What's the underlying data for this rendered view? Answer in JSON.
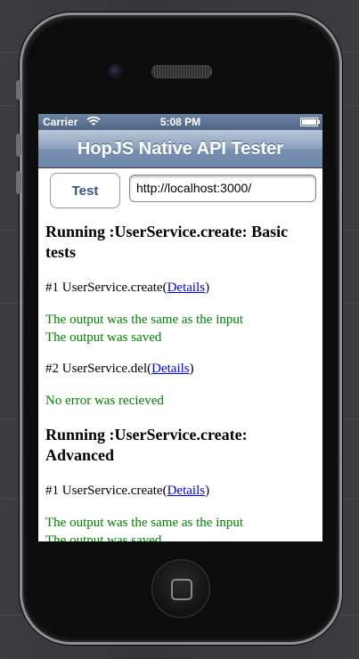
{
  "status_bar": {
    "carrier": "Carrier",
    "time": "5:08 PM"
  },
  "nav": {
    "title": "HopJS Native API Tester"
  },
  "toolbar": {
    "test_label": "Test",
    "url_value": "http://localhost:3000/"
  },
  "results": {
    "basic": {
      "heading": "Running :UserService.create: Basic tests",
      "t1": {
        "prefix": "#1 UserService.create(",
        "link": "Details",
        "suffix": ")"
      },
      "t1_out1": "The output was the same as the input",
      "t1_out2": "The output was saved",
      "t2": {
        "prefix": "#2 UserService.del(",
        "link": "Details",
        "suffix": ")"
      },
      "t2_out1": "No error was recieved"
    },
    "advanced": {
      "heading": "Running :UserService.create: Advanced",
      "t1": {
        "prefix": "#1 UserService.create(",
        "link": "Details",
        "suffix": ")"
      },
      "t1_out1": "The output was the same as the input",
      "t1_out2": "The output was saved"
    }
  },
  "colors": {
    "nav_blue": "#7890b1",
    "button_text": "#385487",
    "success": "#008000",
    "link": "#0000ee"
  },
  "icons": {
    "wifi": "wifi-icon",
    "battery": "battery-icon",
    "home": "home-button-icon"
  }
}
